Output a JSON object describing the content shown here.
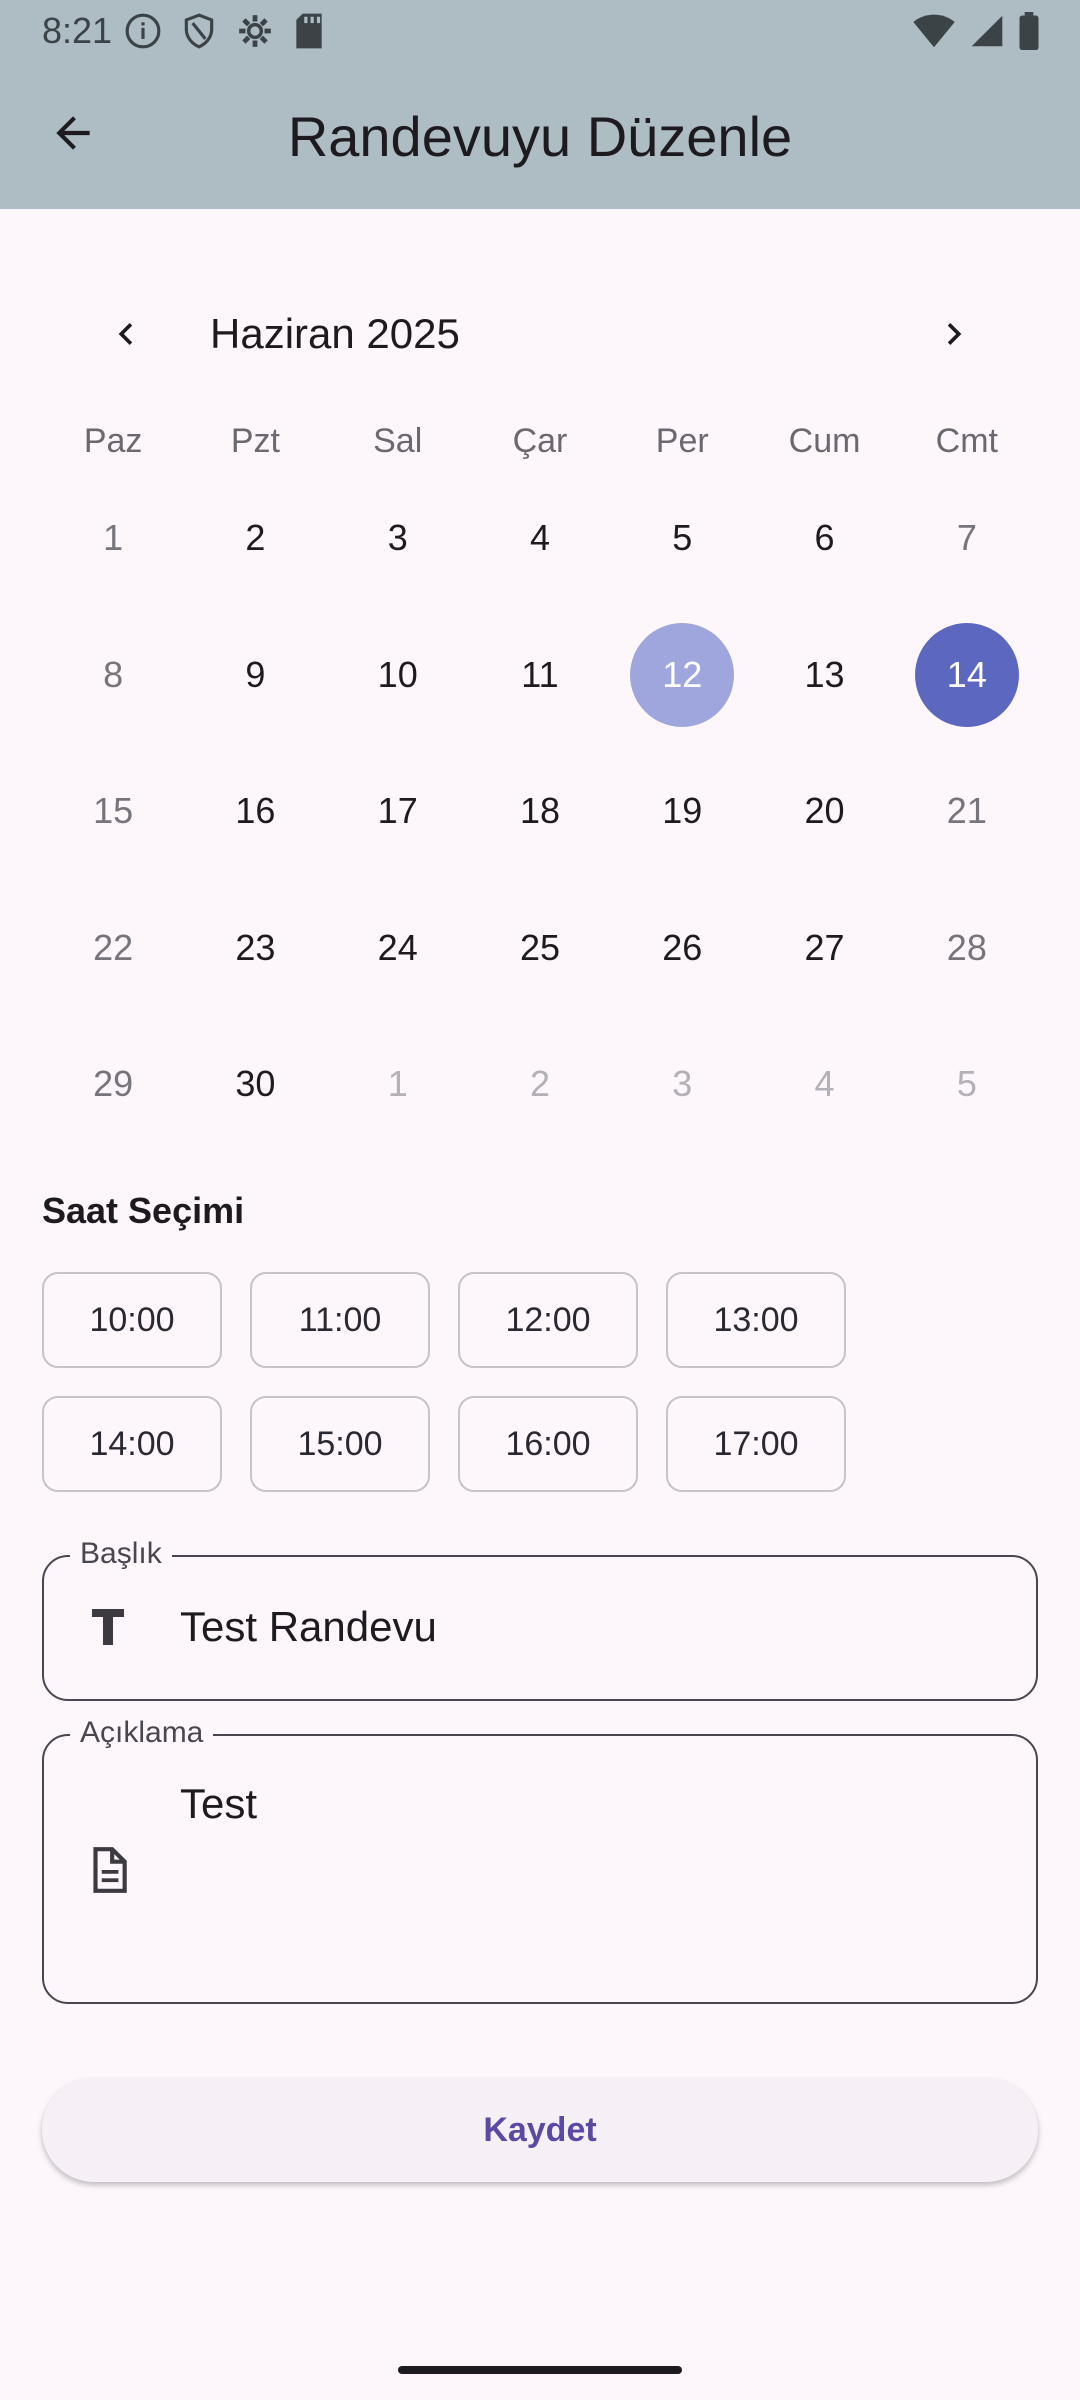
{
  "status_bar": {
    "time": "8:21"
  },
  "app_bar": {
    "title": "Randevuyu Düzenle"
  },
  "calendar": {
    "month_label": "Haziran 2025",
    "weekdays": [
      "Paz",
      "Pzt",
      "Sal",
      "Çar",
      "Per",
      "Cum",
      "Cmt"
    ],
    "weeks": [
      [
        "1",
        "2",
        "3",
        "4",
        "5",
        "6",
        "7"
      ],
      [
        "8",
        "9",
        "10",
        "11",
        "12",
        "13",
        "14"
      ],
      [
        "15",
        "16",
        "17",
        "18",
        "19",
        "20",
        "21"
      ],
      [
        "22",
        "23",
        "24",
        "25",
        "26",
        "27",
        "28"
      ],
      [
        "29",
        "30",
        "1",
        "2",
        "3",
        "4",
        "5"
      ]
    ],
    "today_day": "12",
    "selected_day": "14",
    "colors": {
      "today_bg": "#9ea6dd",
      "selected_bg": "#5c67c0"
    }
  },
  "time_selection": {
    "title": "Saat Seçimi",
    "slots": [
      "10:00",
      "11:00",
      "12:00",
      "13:00",
      "14:00",
      "15:00",
      "16:00",
      "17:00"
    ]
  },
  "title_field": {
    "label": "Başlık",
    "value": "Test Randevu",
    "icon": "text-format-icon"
  },
  "description_field": {
    "label": "Açıklama",
    "value": "Test",
    "icon": "document-icon"
  },
  "save_button": {
    "label": "Kaydet"
  },
  "colors": {
    "app_bar": "#aebdc4",
    "background": "#fdf7fc",
    "accent": "#5a4aa6"
  }
}
